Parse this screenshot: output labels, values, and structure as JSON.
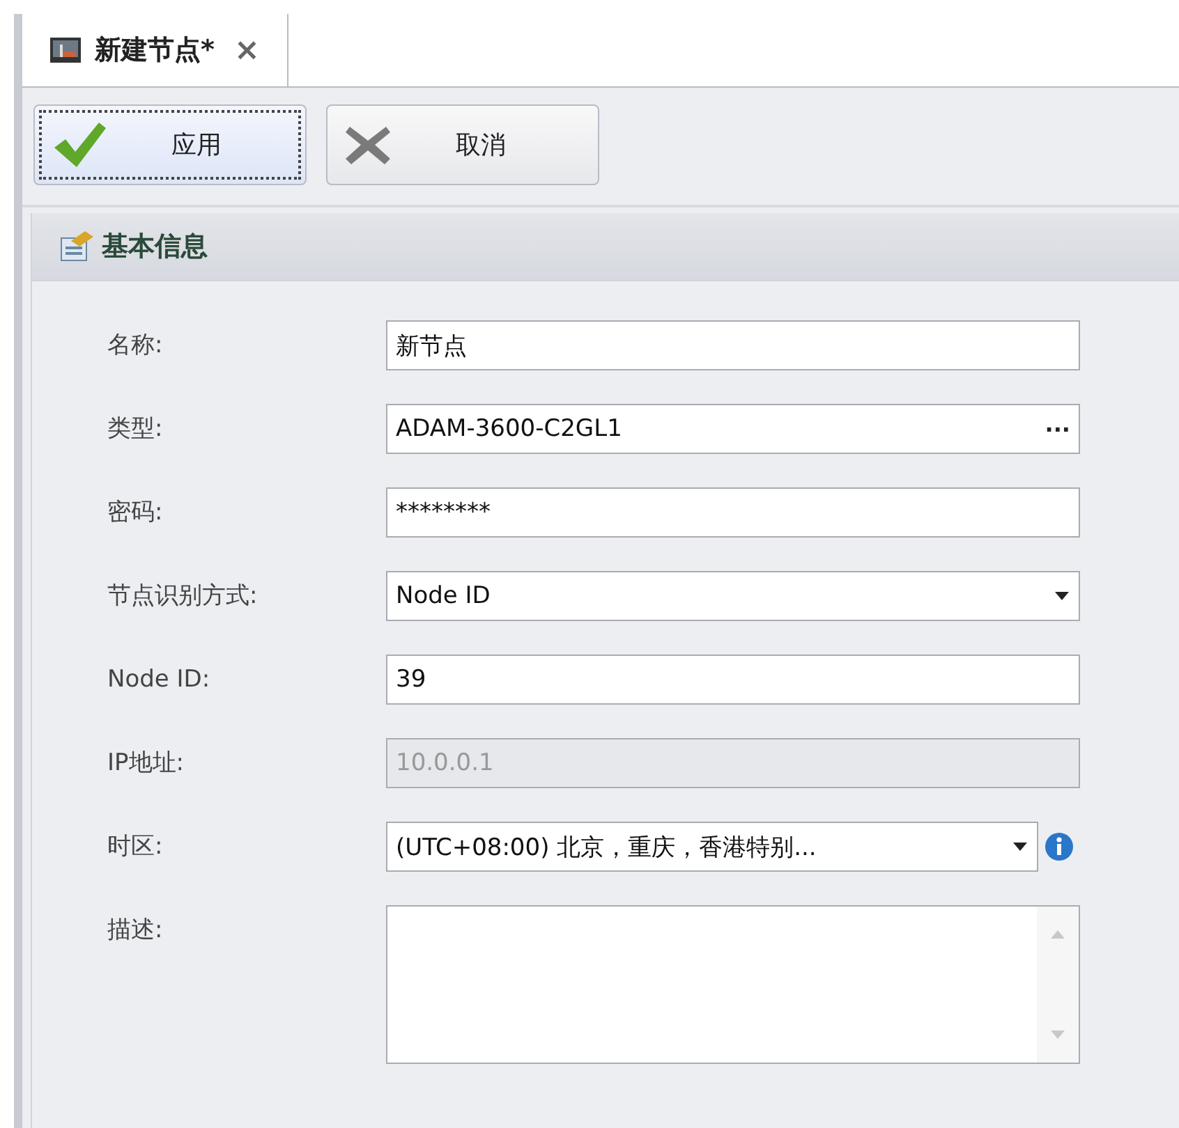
{
  "tab": {
    "title": "新建节点*",
    "close": "×",
    "selected": true
  },
  "toolbar": {
    "buttons": [
      {
        "kind": "apply",
        "label": "应用",
        "focused": true
      },
      {
        "kind": "cancel",
        "label": "取消",
        "focused": false
      }
    ]
  },
  "section": {
    "title": "基本信息"
  },
  "fields": [
    {
      "kind": "text",
      "label": "名称:",
      "value": "新节点",
      "disabled": false
    },
    {
      "kind": "ellipsis",
      "label": "类型:",
      "value": "ADAM-3600-C2GL1",
      "disabled": false,
      "button": "···"
    },
    {
      "kind": "password",
      "label": "密码:",
      "value": "********",
      "disabled": false
    },
    {
      "kind": "dropdown",
      "label": "节点识别方式:",
      "value": "Node ID",
      "disabled": false
    },
    {
      "kind": "text",
      "label": "Node ID:",
      "value": "39",
      "disabled": false
    },
    {
      "kind": "text",
      "label": "IP地址:",
      "value": "10.0.0.1",
      "disabled": true
    },
    {
      "kind": "dropdown-info",
      "label": "时区:",
      "value": "(UTC+08:00) 北京，重庆，香港特别...",
      "disabled": false
    },
    {
      "kind": "memo",
      "label": "描述:",
      "disabled": false
    }
  ]
}
